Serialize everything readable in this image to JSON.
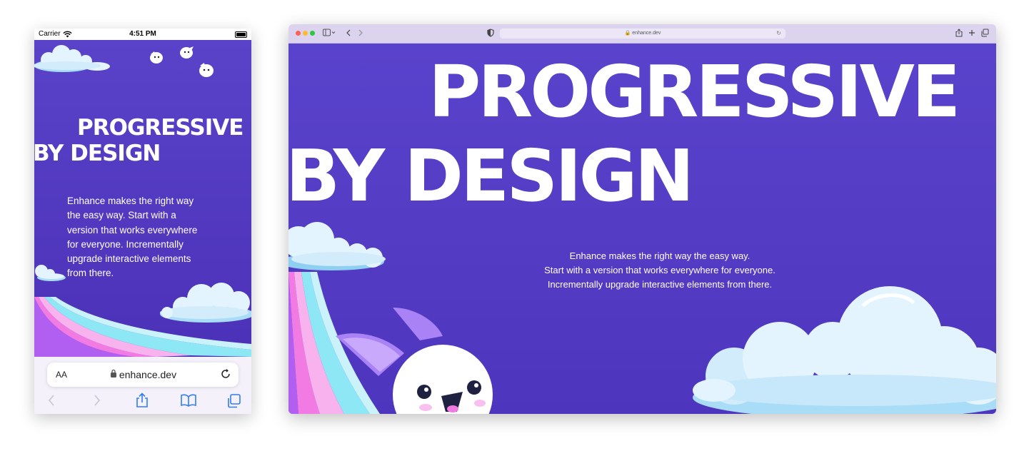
{
  "phone": {
    "status_bar": {
      "carrier": "Carrier",
      "time": "4:51 PM"
    },
    "hero": {
      "title_line1": "PROGRESSIVE",
      "title_line2": "BY DESIGN",
      "description_lines": [
        "Enhance makes the right way",
        "the easy way. Start with a",
        "version that works everywhere",
        "for everyone. Incrementally",
        "upgrade interactive elements",
        "from there."
      ]
    },
    "url_bar": {
      "text_size_label": "AA",
      "url": "enhance.dev"
    },
    "toolbar": [
      "back-icon",
      "forward-icon",
      "share-icon",
      "bookmarks-icon",
      "tabs-icon"
    ]
  },
  "desktop": {
    "address": "enhance.dev",
    "hero": {
      "title_line1": "PROGRESSIVE",
      "title_line2": "BY DESIGN",
      "description_lines": [
        "Enhance makes the right way the easy way.",
        "Start with a version that works everywhere for everyone.",
        "Incrementally upgrade interactive elements from there."
      ]
    }
  },
  "colors": {
    "hero_purple": "#5a43cc",
    "cloud_light": "#e4f4fe",
    "cloud_blue": "#a9dcf7",
    "rainbow_cyan": "#8de7f5",
    "rainbow_pink": "#f27be3",
    "rainbow_violet": "#b15ff0",
    "window_chrome": "#dcd3ef"
  }
}
